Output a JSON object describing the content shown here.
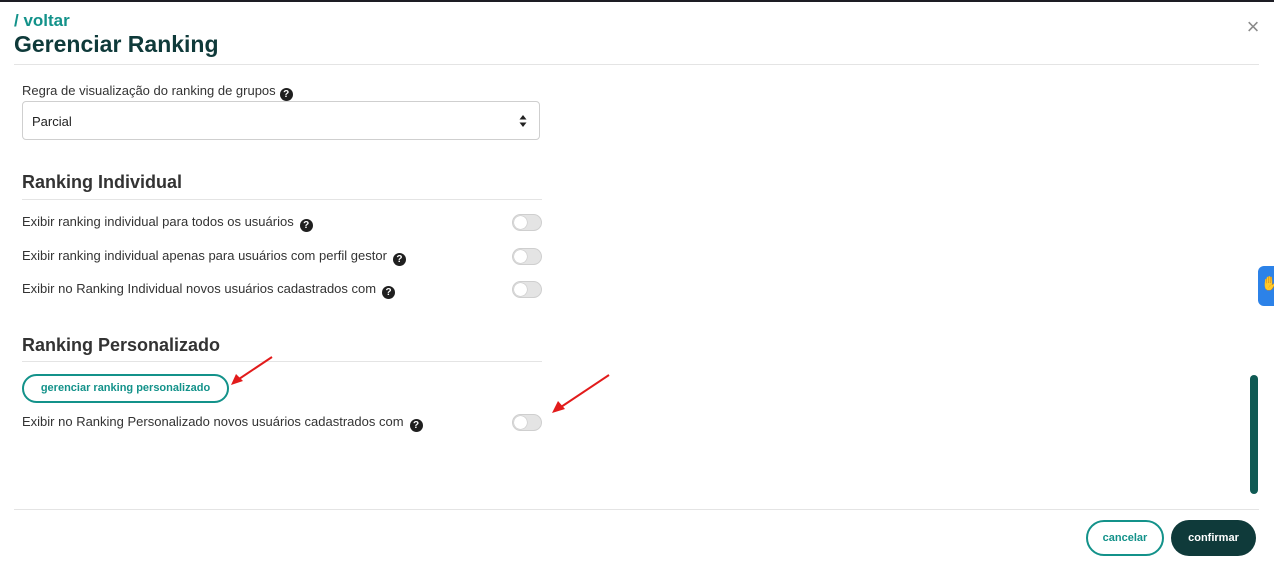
{
  "header": {
    "back_label": "/ voltar",
    "title": "Gerenciar Ranking",
    "close_icon": "×"
  },
  "group_rule": {
    "label": "Regra de visualização do ranking de grupos",
    "selected": "Parcial"
  },
  "ranking_individual": {
    "title": "Ranking Individual",
    "rows": [
      {
        "label": "Exibir ranking individual para todos os usuários",
        "enabled": false
      },
      {
        "label": "Exibir ranking individual apenas para usuários com perfil gestor",
        "enabled": false
      },
      {
        "label": "Exibir no Ranking Individual novos usuários cadastrados com",
        "enabled": false
      }
    ]
  },
  "ranking_personalizado": {
    "title": "Ranking Personalizado",
    "manage_button": "gerenciar ranking personalizado",
    "rows": [
      {
        "label": "Exibir no Ranking Personalizado novos usuários cadastrados com",
        "enabled": false
      }
    ]
  },
  "footer": {
    "cancel_label": "cancelar",
    "confirm_label": "confirmar"
  },
  "help_glyph": "?",
  "colors": {
    "accent": "#13928a",
    "dark": "#0f3a3a",
    "annotation_arrow": "#e21b1b",
    "side_tab": "#2c82e8"
  },
  "icons": {
    "close": "close-icon",
    "help": "question-circle-icon",
    "select_caret": "sort-caret-icon",
    "side_tab": "hand-icon"
  }
}
